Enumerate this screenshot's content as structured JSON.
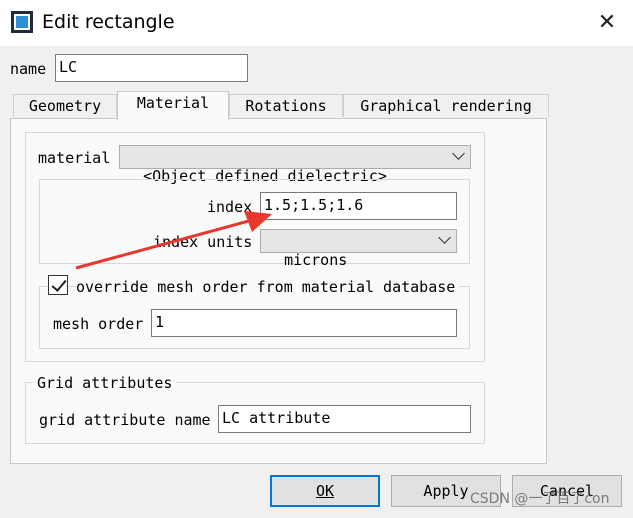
{
  "window": {
    "title": "Edit rectangle"
  },
  "name_field": {
    "label": "name",
    "value": "LC"
  },
  "tabs": [
    {
      "label": "Geometry"
    },
    {
      "label": "Material"
    },
    {
      "label": "Rotations"
    },
    {
      "label": "Graphical rendering"
    }
  ],
  "material": {
    "label": "material",
    "selected": "<Object defined dielectric>",
    "index_label": "index",
    "index_value": "1.5;1.5;1.6",
    "units_label": "index units",
    "units_selected": "microns",
    "override_label": "override mesh order from material database",
    "override_checked": true,
    "mesh_order_label": "mesh order",
    "mesh_order_value": "1"
  },
  "grid": {
    "title": "Grid attributes",
    "name_label": "grid attribute name",
    "name_value": "LC attribute"
  },
  "buttons": {
    "ok": "OK",
    "apply": "Apply",
    "cancel": "Cancel"
  },
  "watermark": "CSDN @一了百了con",
  "annotation": {
    "type": "red-arrow",
    "color": "#e8372c"
  },
  "colors": {
    "accent": "#0078d7",
    "annotation": "#e8372c"
  }
}
